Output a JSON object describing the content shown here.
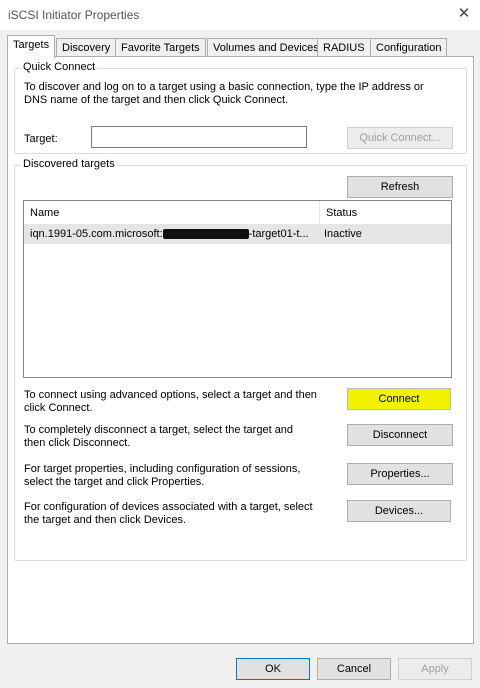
{
  "window": {
    "title": "iSCSI Initiator Properties",
    "close_label": "✕"
  },
  "tabs": [
    {
      "label": "Targets",
      "active": true
    },
    {
      "label": "Discovery"
    },
    {
      "label": "Favorite Targets"
    },
    {
      "label": "Volumes and Devices"
    },
    {
      "label": "RADIUS"
    },
    {
      "label": "Configuration"
    }
  ],
  "quick_connect": {
    "group_label": "Quick Connect",
    "description_line1": "To discover and log on to a target using a basic connection, type the IP address or",
    "description_line2": "DNS name of the target and then click Quick Connect.",
    "target_label": "Target:",
    "target_value": "",
    "button_label": "Quick Connect..."
  },
  "discovered_targets": {
    "group_label": "Discovered targets",
    "refresh_label": "Refresh",
    "columns": [
      "Name",
      "Status"
    ],
    "rows": [
      {
        "name_prefix": "iqn.1991-05.com.microsoft:",
        "name_suffix": "-target01-t...",
        "status": "Inactive"
      }
    ]
  },
  "actions": [
    {
      "line1": "To connect using advanced options, select a target and then",
      "line2": "click Connect.",
      "button": "Connect"
    },
    {
      "line1": "To completely disconnect a target, select the target and",
      "line2": "then click Disconnect.",
      "button": "Disconnect"
    },
    {
      "line1": "For target properties, including configuration of sessions,",
      "line2": "select the target and click Properties.",
      "button": "Properties..."
    },
    {
      "line1": "For configuration of devices associated with a target, select",
      "line2": "the target and then click Devices.",
      "button": "Devices..."
    }
  ],
  "footer": {
    "ok_label": "OK",
    "cancel_label": "Cancel",
    "apply_label": "Apply"
  }
}
